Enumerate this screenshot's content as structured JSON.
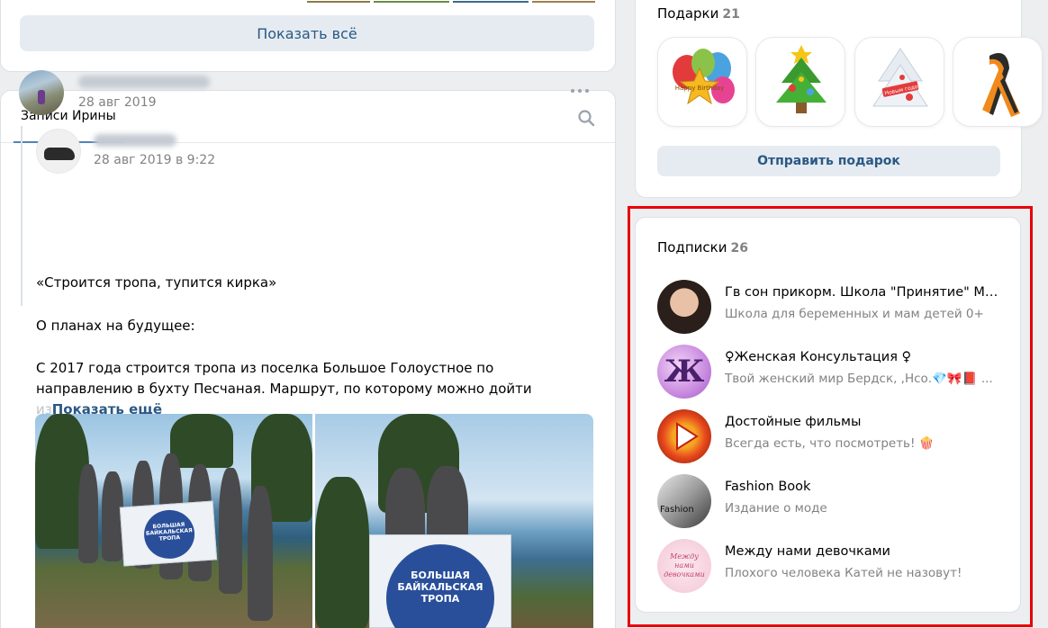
{
  "top_card": {
    "show_all_label": "Показать всё"
  },
  "wall": {
    "tab_label": "Записи Ирины",
    "post": {
      "date": "28 авг 2019",
      "repost": {
        "date": "28 авг 2019 в 9:22"
      },
      "text_line1": "«Строится тропа, тупится кирка»",
      "text_line2": "О планах на будущее:",
      "text_line3_a": "С 2017 года строится тропа из поселка Большое Голоустное по направлению в бухту Песчаная. Маршрут, по которому можно дойти",
      "text_line3_fade": " из",
      "show_more": "Показать ещё",
      "flag_text": "БОЛЬШАЯ\nБАЙКАЛЬСКАЯ\nТРОПА",
      "flag_text_small": "БОЛЬШАЯ БАЙКАЛЬСКАЯ ТРОПА"
    }
  },
  "gifts": {
    "title": "Подарки",
    "count": "21",
    "send_label": "Отправить подарок",
    "items": [
      {
        "icon": "balloons-gift-icon",
        "label": "Happy Birthday"
      },
      {
        "icon": "christmas-tree-gift-icon"
      },
      {
        "icon": "white-tree-gift-icon",
        "label": "С Новым годом"
      },
      {
        "icon": "st-george-ribbon-gift-icon"
      }
    ]
  },
  "subscriptions": {
    "title": "Подписки",
    "count": "26",
    "items": [
      {
        "name": "Гв сон прикорм. Школа \"Принятие\" Ма...",
        "desc": "Школа для беременных и мам детей 0+"
      },
      {
        "name": "♀Женская Консультация ♀",
        "desc": "Твой женский мир Бердск, ,Нсо.💎🎀📕 ...",
        "avatar_letter": "Ж"
      },
      {
        "name": "Достойные фильмы",
        "desc": "Всегда есть, что посмотреть! 🍿"
      },
      {
        "name": "Fashion Book",
        "desc": "Издание о моде",
        "avatar_text": "Fashion"
      },
      {
        "name": "Между нами девочками",
        "desc": "Плохого человека Катей не назовут!",
        "avatar_text": "Между нами девочками"
      }
    ]
  },
  "colors": {
    "link": "#2a5885",
    "button_bg": "#e5ebf1",
    "muted": "#828282",
    "highlight": "#e8000a"
  }
}
